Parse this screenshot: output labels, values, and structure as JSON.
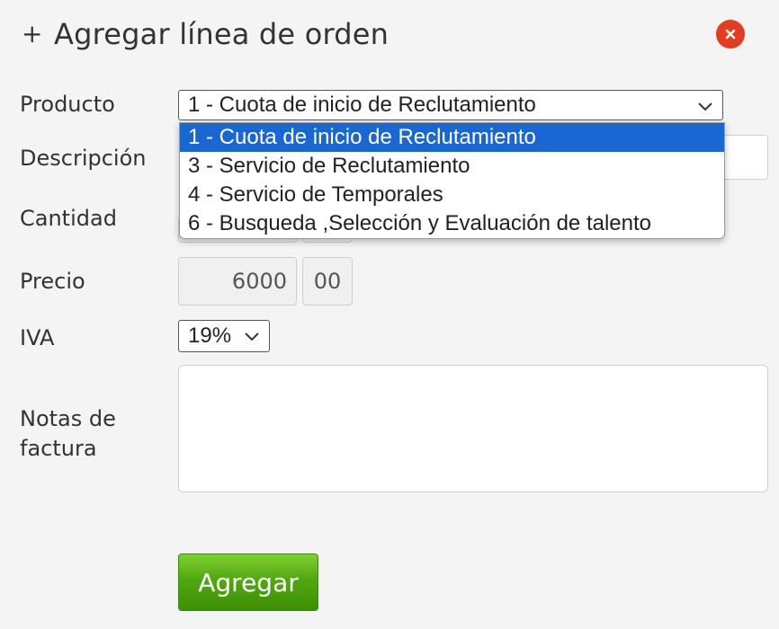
{
  "dialog": {
    "title": "Agregar línea de orden",
    "title_icon": "plus-icon",
    "close_icon": "close-icon",
    "close_color": "#e53c1f"
  },
  "form": {
    "product_label": "Producto",
    "product_selected": "1 - Cuota de inicio de Reclutamiento",
    "product_options": [
      "1 - Cuota de inicio de Reclutamiento",
      "3 - Servicio de Reclutamiento",
      "4 - Servicio de Temporales",
      "6 - Busqueda ,Selección y Evaluación de talento"
    ],
    "description_label": "Descripción",
    "quantity_label": "Cantidad",
    "price_label": "Precio",
    "price_whole": "6000",
    "price_cents": "00",
    "iva_label": "IVA",
    "iva_selected": "19%",
    "notes_label_line1": "Notas de",
    "notes_label_line2": "factura",
    "notes_value": "",
    "submit_label": "Agregar"
  },
  "colors": {
    "selected_option": "#1a66d2",
    "submit_button": "#52a811"
  }
}
